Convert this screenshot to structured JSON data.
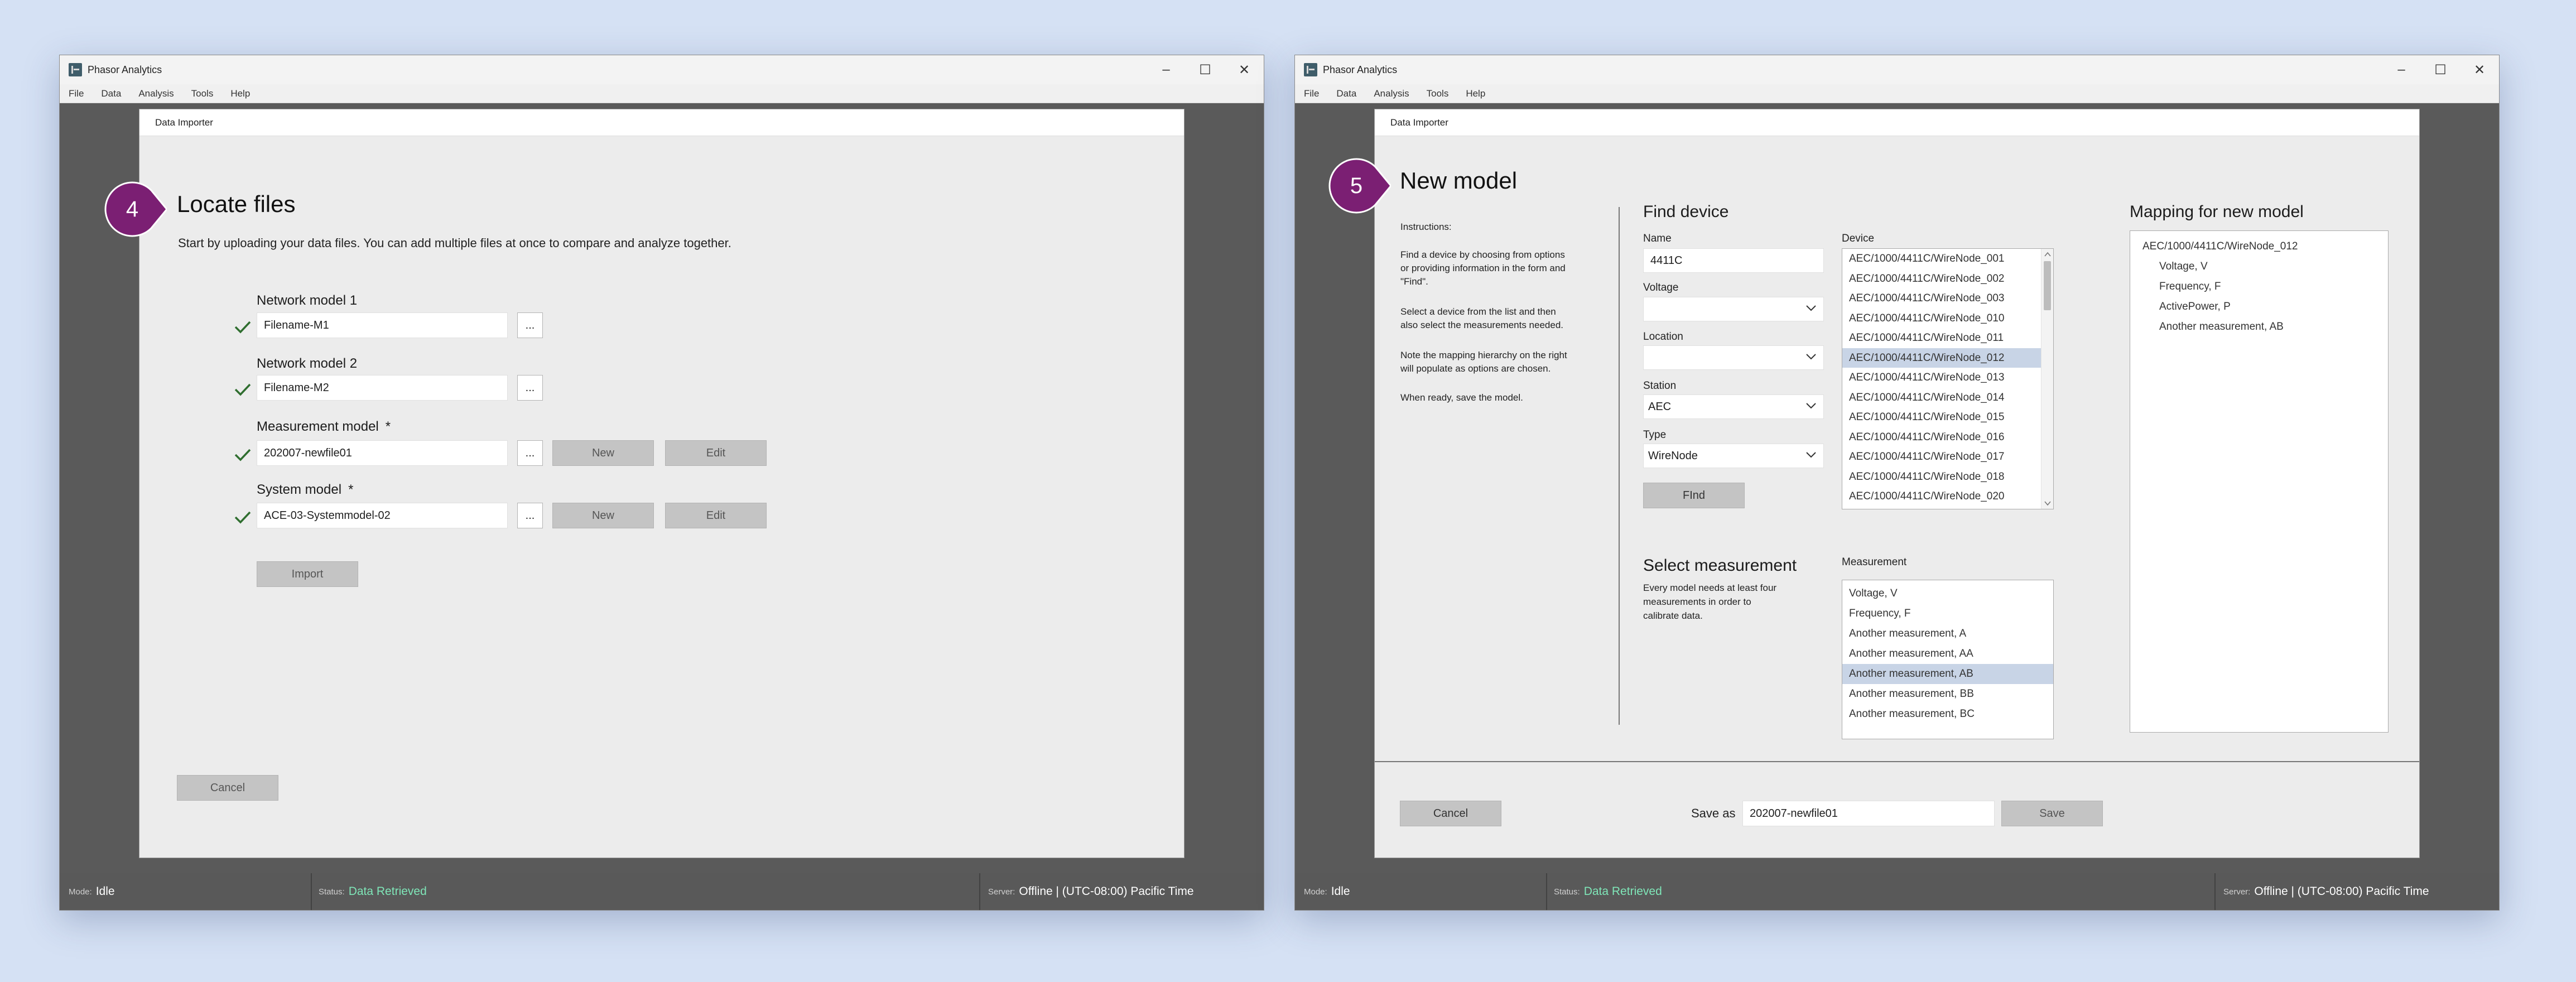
{
  "colors": {
    "background": "#d5e1f4",
    "badge": "#7b1f73",
    "status_ok": "#7fe6b8",
    "check": "#2f6e2f",
    "selected_row": "#c8d4e6"
  },
  "windows": [
    {
      "app_title": "Phasor Analytics",
      "menu": [
        "File",
        "Data",
        "Analysis",
        "Tools",
        "Help"
      ],
      "dialog_title": "Data Importer",
      "step": "4",
      "heading": "Locate files",
      "intro": "Start by uploading your data files. You can add multiple files at once to compare and analyze together.",
      "fields": [
        {
          "label": "Network model 1",
          "value": "Filename-M1",
          "required": false,
          "browse": "...",
          "checked": true
        },
        {
          "label": "Network model 2",
          "value": "Filename-M2",
          "required": false,
          "browse": "...",
          "checked": true
        },
        {
          "label": "Measurement model",
          "value": "202007-newfile01",
          "required": true,
          "browse": "...",
          "new": "New",
          "edit": "Edit",
          "checked": true
        },
        {
          "label": "System model",
          "value": "ACE-03-Systemmodel-02",
          "required": true,
          "browse": "...",
          "new": "New",
          "edit": "Edit",
          "checked": true
        }
      ],
      "required_mark": "*",
      "import_label": "Import",
      "cancel_label": "Cancel",
      "status": {
        "mode_label": "Mode:",
        "mode_value": "Idle",
        "status_label": "Status:",
        "status_value": "Data Retrieved",
        "server_label": "Server:",
        "server_value": "Offline | (UTC-08:00) Pacific Time"
      }
    },
    {
      "app_title": "Phasor Analytics",
      "menu": [
        "File",
        "Data",
        "Analysis",
        "Tools",
        "Help"
      ],
      "dialog_title": "Data Importer",
      "step": "5",
      "heading": "New model",
      "instructions_title": "Instructions:",
      "instructions": [
        [
          "Find a device by choosing from options",
          "or providing information in the form and",
          "\"Find\"."
        ],
        [
          "Select a device from the list and then",
          "also select the measurements needed."
        ],
        [
          "Note the mapping hierarchy on the right",
          "will populate as options are chosen."
        ],
        [
          "When ready, save the model."
        ]
      ],
      "find_device_title": "Find device",
      "name_label": "Name",
      "name_value": "4411C",
      "voltage_label": "Voltage",
      "voltage_value": "",
      "location_label": "Location",
      "location_value": "",
      "station_label": "Station",
      "station_value": "AEC",
      "type_label": "Type",
      "type_value": "WireNode",
      "find_label": "FInd",
      "device_label": "Device",
      "devices": [
        "AEC/1000/4411C/WireNode_001",
        "AEC/1000/4411C/WireNode_002",
        "AEC/1000/4411C/WireNode_003",
        "AEC/1000/4411C/WireNode_010",
        "AEC/1000/4411C/WireNode_011",
        "AEC/1000/4411C/WireNode_012",
        "AEC/1000/4411C/WireNode_013",
        "AEC/1000/4411C/WireNode_014",
        "AEC/1000/4411C/WireNode_015",
        "AEC/1000/4411C/WireNode_016",
        "AEC/1000/4411C/WireNode_017",
        "AEC/1000/4411C/WireNode_018",
        "AEC/1000/4411C/WireNode_020"
      ],
      "selected_device": "AEC/1000/4411C/WireNode_012",
      "select_measurement_title": "Select measurement",
      "measurement_note": [
        "Every model needs at least four",
        "measurements in order to",
        "calibrate data."
      ],
      "measurement_label": "Measurement",
      "measurements": [
        "Voltage, V",
        "Frequency, F",
        "Another measurement, A",
        "Another measurement, AA",
        "Another measurement, AB",
        "Another measurement, BB",
        "Another measurement, BC"
      ],
      "selected_measurement": "Another measurement, AB",
      "mapping_title": "Mapping for new model",
      "mapping_root": "AEC/1000/4411C/WireNode_012",
      "mapping_children": [
        "Voltage, V",
        "Frequency, F",
        "ActivePower, P",
        "Another measurement, AB"
      ],
      "cancel_label": "Cancel",
      "save_as_label": "Save as",
      "save_as_value": "202007-newfile01",
      "save_label": "Save",
      "status": {
        "mode_label": "Mode:",
        "mode_value": "Idle",
        "status_label": "Status:",
        "status_value": "Data Retrieved",
        "server_label": "Server:",
        "server_value": "Offline | (UTC-08:00) Pacific Time"
      }
    }
  ]
}
